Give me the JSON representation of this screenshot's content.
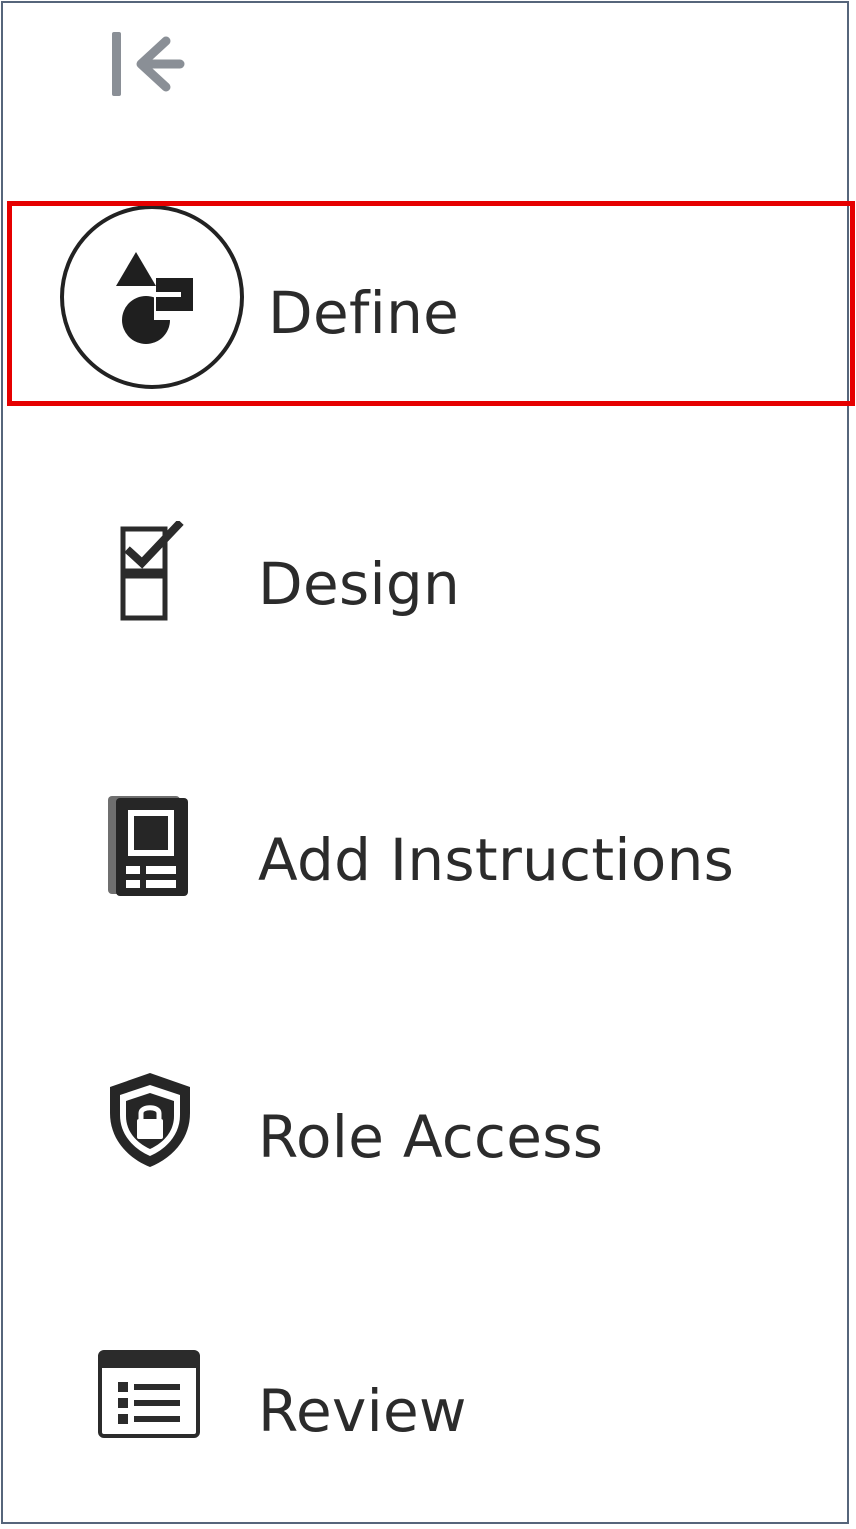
{
  "nav": {
    "collapse_icon": "collapse-left-icon",
    "accent_color": "#e60000",
    "border_color": "#56657b",
    "active_index": 0,
    "items": [
      {
        "label": "Define",
        "icon": "shapes-icon"
      },
      {
        "label": "Design",
        "icon": "checklist-icon"
      },
      {
        "label": "Add Instructions",
        "icon": "instructions-device-icon"
      },
      {
        "label": "Role Access",
        "icon": "shield-lock-icon"
      },
      {
        "label": "Review",
        "icon": "list-window-icon"
      }
    ]
  }
}
